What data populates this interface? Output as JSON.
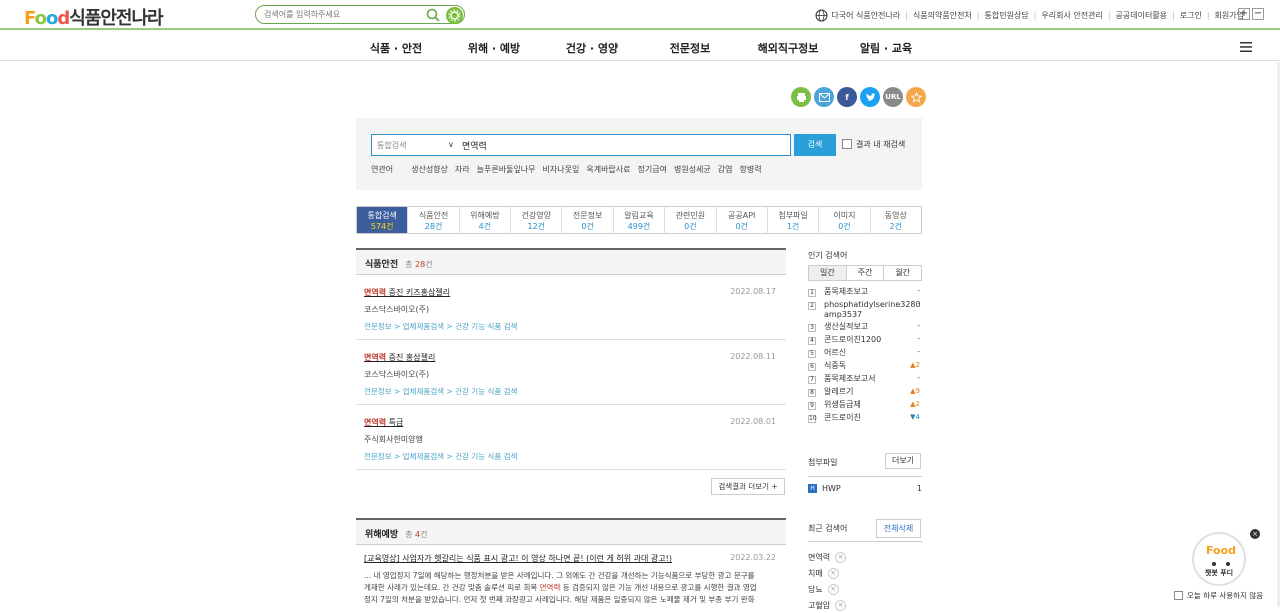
{
  "header": {
    "logo_text": "식품안전나라",
    "logo_food": [
      "F",
      "o",
      "o",
      "d"
    ],
    "search_placeholder": "검색어를 입력하주세요",
    "util_links": [
      "다국어 식품안전나라",
      "식품의약품안전처",
      "통합민원상담",
      "우리회사 안전관리",
      "공공데이터활용",
      "로그인",
      "회원가입"
    ],
    "zoom_in": "+",
    "zoom_out": "−"
  },
  "gnb": [
    "식품 · 안전",
    "위해 · 예방",
    "건강 · 영양",
    "전문정보",
    "해외직구정보",
    "알림 · 교육"
  ],
  "share": {
    "print": "print-icon",
    "mail": "mail-icon",
    "facebook": "f",
    "twitter": "twitter-icon",
    "url": "URL",
    "fav": "star-icon",
    "colors": [
      "#7cbf45",
      "#4aa3d9",
      "#3b5998",
      "#1da1f2",
      "#8a8a8a",
      "#f5a64a"
    ]
  },
  "search": {
    "category": "통합검색",
    "arrow": "∨",
    "value": "면역력",
    "button": "검색",
    "within": "결과 내 재검색",
    "related_label": "연관어",
    "related": [
      "생산성향상",
      "자라",
      "늘푸른바둘잎나무",
      "비자나못잎",
      "옥계바랍사료",
      "정기급여",
      "병원성세균",
      "감염",
      "항병력"
    ]
  },
  "tabs": [
    {
      "label": "통합검색",
      "count": "574건"
    },
    {
      "label": "식품안전",
      "count": "28건"
    },
    {
      "label": "위해예방",
      "count": "4건"
    },
    {
      "label": "건강영양",
      "count": "12건"
    },
    {
      "label": "전문정보",
      "count": "0건"
    },
    {
      "label": "알림교육",
      "count": "499건"
    },
    {
      "label": "관련민원",
      "count": "0건"
    },
    {
      "label": "공공API",
      "count": "0건"
    },
    {
      "label": "첨부파일",
      "count": "1건"
    },
    {
      "label": "이미지",
      "count": "0건"
    },
    {
      "label": "동영상",
      "count": "2건"
    }
  ],
  "food_safety": {
    "title": "식품안전",
    "total_prefix": "총",
    "total": "28",
    "total_suffix": "건",
    "items": [
      {
        "hl": "면역력",
        "rest": " 증진 키즈홍삼젤리",
        "date": "2022.08.17",
        "company": "코스닥스바이오(주)",
        "path": "전문정보 > 업체제품검색 > 건강 기능 식품 검색"
      },
      {
        "hl": "면역력",
        "rest": " 증진 홍삼젤리",
        "date": "2022.08.11",
        "company": "코스닥스바이오(주)",
        "path": "전문정보 > 업체제품검색 > 건강 기능 식품 검색"
      },
      {
        "hl": "면역력",
        "rest": " 특급",
        "date": "2022.08.01",
        "company": "주식회사한미양행",
        "path": "전문정보 > 업체제품검색 > 건강 기능 식품 검색"
      }
    ],
    "more": "검색결과 더보기 +"
  },
  "hazard": {
    "title": "위해예방",
    "total_prefix": "총",
    "total": "4",
    "total_suffix": "건",
    "item": {
      "title": "[교육영상] 사업자가 헷갈리는 식품 표시 광고! 이 영상 하나면 끝! (이런 게 허위 과대 광고!)",
      "date": "2022.03.22",
      "desc1": "... 내 영업정지 7일에 해당하는 행정처분을 받은 사례입니다. 그 외에도 간 건강을 개선하는 기능식품으로 부당한 광고 문구를",
      "desc2": "게재한 사례가 있는데요. 간 건강 맞춤 솔루션 피로 회복 ",
      "desc2_hl": "면역력",
      "desc2b": " 등 검증되지 않은 기능 개선 내용으로 광고를 시행한 결과 영업",
      "desc3": "정지 7일의 처분을 받았습니다. 먼저 첫 번째 과장광고 사례입니다. 해당 제품은 일중되지 않은 노페물 제거 및 부종 부기 완화"
    }
  },
  "popular": {
    "title": "인기 검색어",
    "tabs": [
      "일간",
      "주간",
      "월간"
    ],
    "items": [
      {
        "n": "1",
        "w": "품목제조보고",
        "r": "-",
        "t": ""
      },
      {
        "n": "2",
        "w": "phosphatidylserine3280amp3537",
        "r": "-",
        "t": ""
      },
      {
        "n": "3",
        "w": "생산실적보고",
        "r": "-",
        "t": ""
      },
      {
        "n": "4",
        "w": "콘드로이친1200",
        "r": "-",
        "t": ""
      },
      {
        "n": "5",
        "w": "어르신",
        "r": "-",
        "t": ""
      },
      {
        "n": "6",
        "w": "식중독",
        "r": "▲2",
        "t": "up"
      },
      {
        "n": "7",
        "w": "품목제조보고서",
        "r": "-",
        "t": ""
      },
      {
        "n": "8",
        "w": "알레르기",
        "r": "▲9",
        "t": "up"
      },
      {
        "n": "9",
        "w": "위생등급제",
        "r": "▲2",
        "t": "up"
      },
      {
        "n": "10",
        "w": "콘드로이친",
        "r": "▼4",
        "t": "dn"
      }
    ]
  },
  "attach": {
    "title": "첨부파일",
    "more": "더보기",
    "type": "HWP",
    "icon": "H",
    "count": "1"
  },
  "recent": {
    "title": "최근 검색어",
    "clear": "전체삭제",
    "items": [
      "면역력",
      "치매",
      "당뇨",
      "고혈압"
    ],
    "x": "×"
  },
  "chatbot": {
    "label": "챗봇 푸디",
    "logo": "Food",
    "close": "×",
    "today": "오늘 하루 사용하지 않음"
  }
}
